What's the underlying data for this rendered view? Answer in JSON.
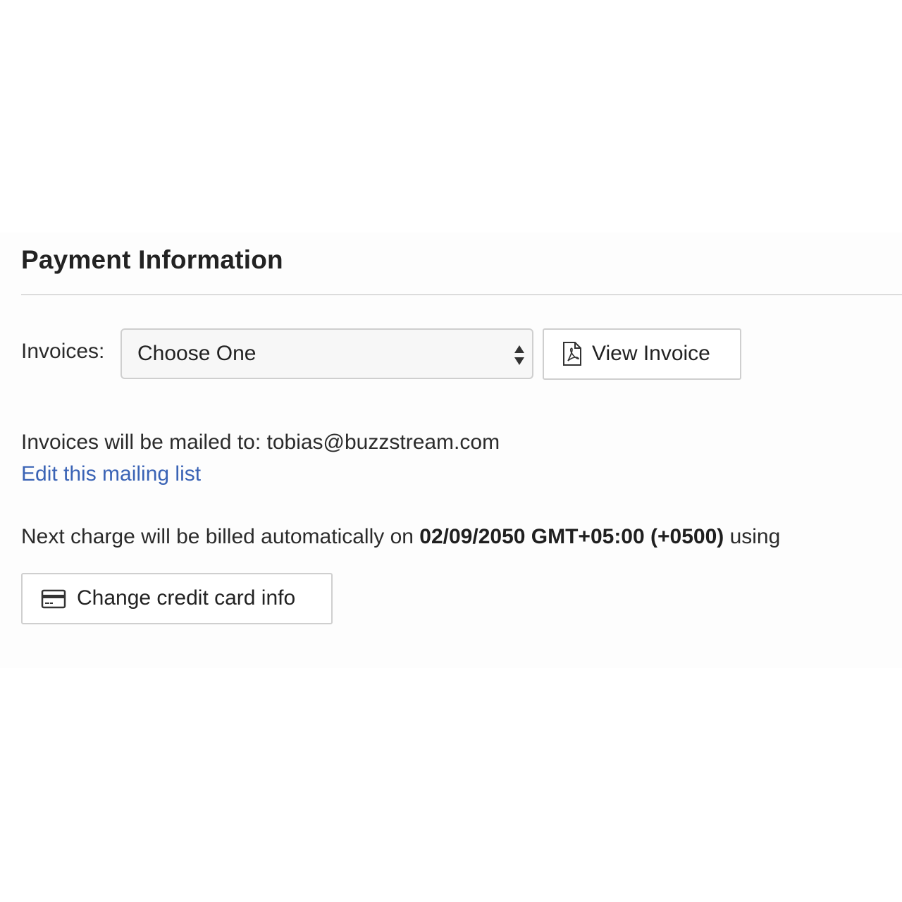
{
  "section": {
    "title": "Payment Information"
  },
  "invoices": {
    "label": "Invoices:",
    "select_value": "Choose One",
    "view_button_label": "View Invoice"
  },
  "mailing": {
    "text": "Invoices will be mailed to: tobias@buzzstream.com",
    "edit_link": "Edit this mailing list"
  },
  "billing": {
    "prefix": "Next charge will be billed automatically on ",
    "date": "02/09/2050 GMT+05:00 (+0500)",
    "suffix": " using",
    "change_card_label": "Change credit card info"
  },
  "icons": {
    "select_arrows": "sort-arrows-icon",
    "view_invoice": "pdf-file-icon",
    "change_card": "credit-card-icon"
  },
  "colors": {
    "link": "#3a63b5",
    "text": "#262626",
    "border": "#cfcfcf"
  }
}
